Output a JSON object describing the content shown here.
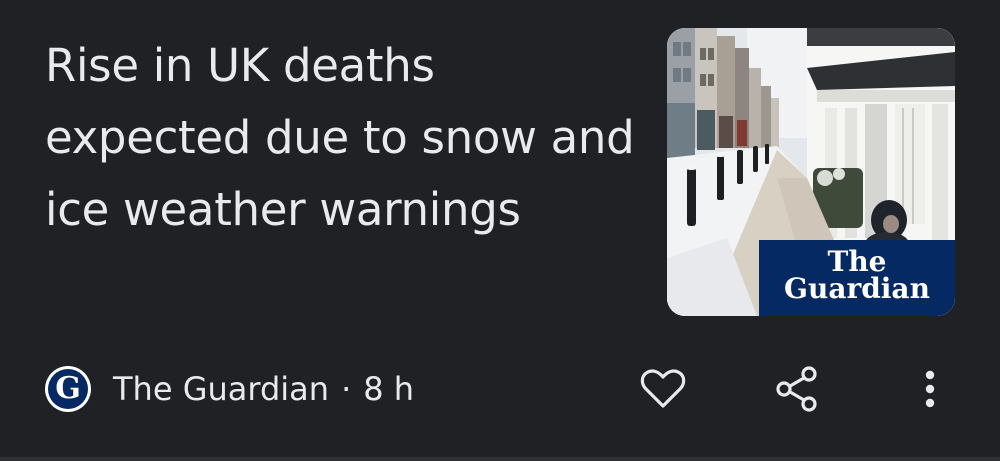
{
  "article": {
    "headline": "Rise in UK deaths expected due to snow and ice weather warnings",
    "thumbnail_watermark": "The Guardian",
    "source_name": "The Guardian",
    "source_logo_letter": "G",
    "separator": "·",
    "age": "8 h"
  },
  "actions": {
    "like_icon": "heart-icon",
    "share_icon": "share-icon",
    "more_icon": "more-vert-icon"
  },
  "colors": {
    "background": "#202124",
    "text": "#e8eaed",
    "guardian_blue": "#052962"
  }
}
